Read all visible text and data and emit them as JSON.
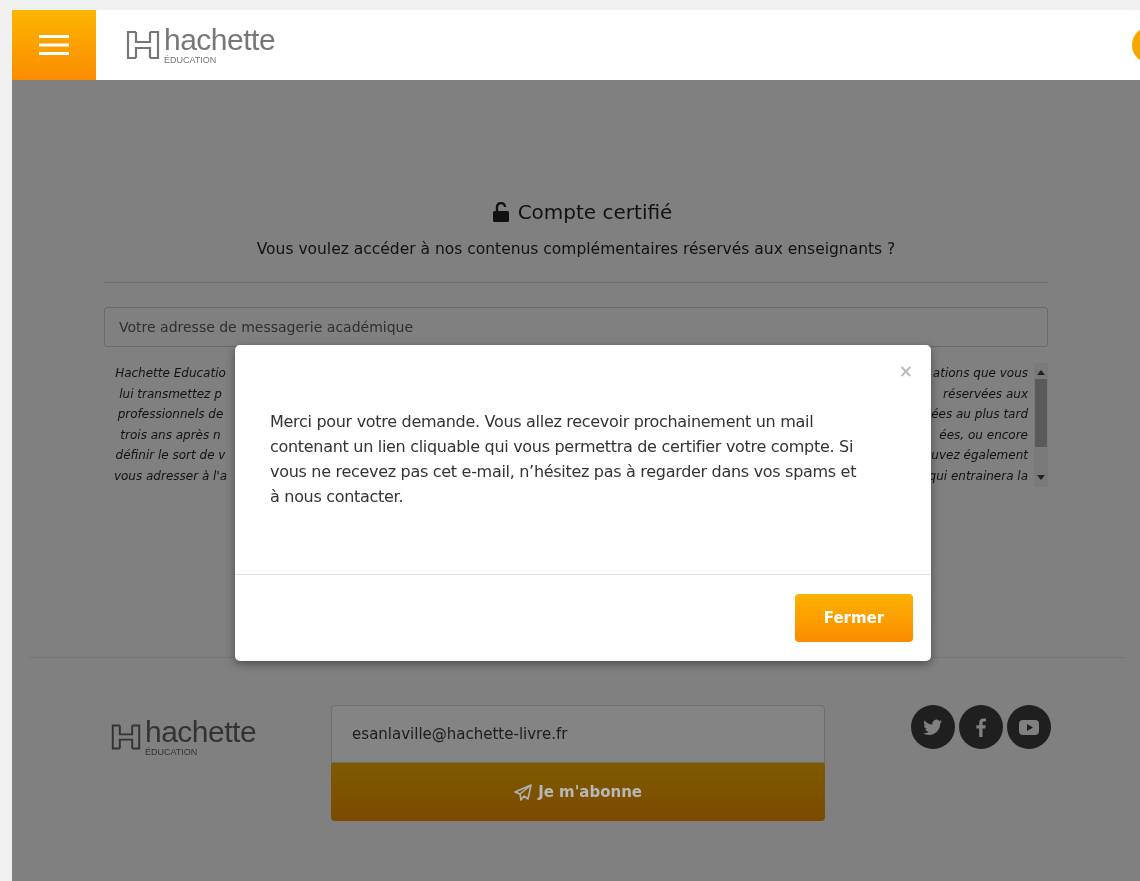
{
  "header": {
    "logo": {
      "name": "hachette",
      "sub": "ÉDUCATION"
    }
  },
  "certification": {
    "title": "Compte certifié",
    "subtitle": "Vous voulez accéder à nos contenus complémentaires réservés aux enseignants ?",
    "email_field": {
      "placeholder": "Votre adresse de messagerie académique"
    },
    "legal_text": [
      {
        "left": "Hachette Educatio",
        "right": "ations que vous"
      },
      {
        "left": "lui transmettez p",
        "right": "réservées aux"
      },
      {
        "left": "professionnels de",
        "right": "ées au plus tard"
      },
      {
        "left": "trois ans après n",
        "right": "ées, ou encore"
      },
      {
        "left": "définir le sort de v",
        "right": "uvez également"
      },
      {
        "left": "vous adresser à l'a",
        "right": "qui entrainera la"
      }
    ]
  },
  "modal": {
    "close": "×",
    "message": "Merci pour votre demande. Vous allez recevoir prochainement un mail contenant un lien cliquable qui vous permettra de certifier votre compte. Si vous ne recevez pas cet e-mail, n’hésitez pas à regarder dans vos spams et à nous contacter.",
    "button": "Fermer"
  },
  "footer": {
    "logo": {
      "name": "hachette",
      "sub": "ÉDUCATION"
    },
    "newsletter": {
      "value": "esanlaville@hachette-livre.fr",
      "button": "Je m'abonne"
    }
  }
}
